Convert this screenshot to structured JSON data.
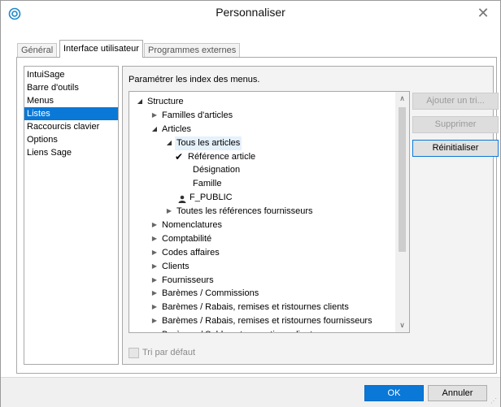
{
  "window": {
    "title": "Personnaliser",
    "close_glyph": "✕",
    "app_icon": "sage-logo-icon"
  },
  "tabs": [
    {
      "label": "Général"
    },
    {
      "label": "Interface utilisateur"
    },
    {
      "label": "Programmes externes"
    }
  ],
  "sidebar": {
    "items": [
      {
        "label": "IntuiSage"
      },
      {
        "label": "Barre d'outils"
      },
      {
        "label": "Menus"
      },
      {
        "label": "Listes"
      },
      {
        "label": "Raccourcis clavier"
      },
      {
        "label": "Options"
      },
      {
        "label": "Liens Sage"
      }
    ],
    "selected": "Listes"
  },
  "panel": {
    "heading": "Paramétrer les index des menus.",
    "tree": [
      {
        "label": "Structure",
        "state": "expanded"
      },
      {
        "label": "Familles d'articles",
        "state": "collapsed"
      },
      {
        "label": "Articles",
        "state": "expanded"
      },
      {
        "label": "Tous les articles",
        "state": "expanded"
      },
      {
        "label": "Référence article",
        "state": "checked"
      },
      {
        "label": "Désignation",
        "state": "leaf"
      },
      {
        "label": "Famille",
        "state": "leaf"
      },
      {
        "label": "F_PUBLIC",
        "state": "user"
      },
      {
        "label": "Toutes les références fournisseurs",
        "state": "collapsed"
      },
      {
        "label": "Nomenclatures",
        "state": "collapsed"
      },
      {
        "label": "Comptabilité",
        "state": "collapsed"
      },
      {
        "label": "Codes affaires",
        "state": "collapsed"
      },
      {
        "label": "Clients",
        "state": "collapsed"
      },
      {
        "label": "Fournisseurs",
        "state": "collapsed"
      },
      {
        "label": "Barèmes / Commissions",
        "state": "collapsed"
      },
      {
        "label": "Barèmes / Rabais, remises et ristournes clients",
        "state": "collapsed"
      },
      {
        "label": "Barèmes / Rabais, remises et ristournes fournisseurs",
        "state": "collapsed"
      },
      {
        "label": "Barèmes / Soldes et promotions clients",
        "state": "collapsed"
      }
    ],
    "buttons": {
      "add": "Ajouter un tri...",
      "delete": "Supprimer",
      "reset": "Réinitialiser"
    },
    "checkbox_label": "Tri par défaut"
  },
  "footer": {
    "ok": "OK",
    "cancel": "Annuler"
  },
  "colors": {
    "accent": "#0a78d7",
    "border": "#a9a9a9"
  }
}
